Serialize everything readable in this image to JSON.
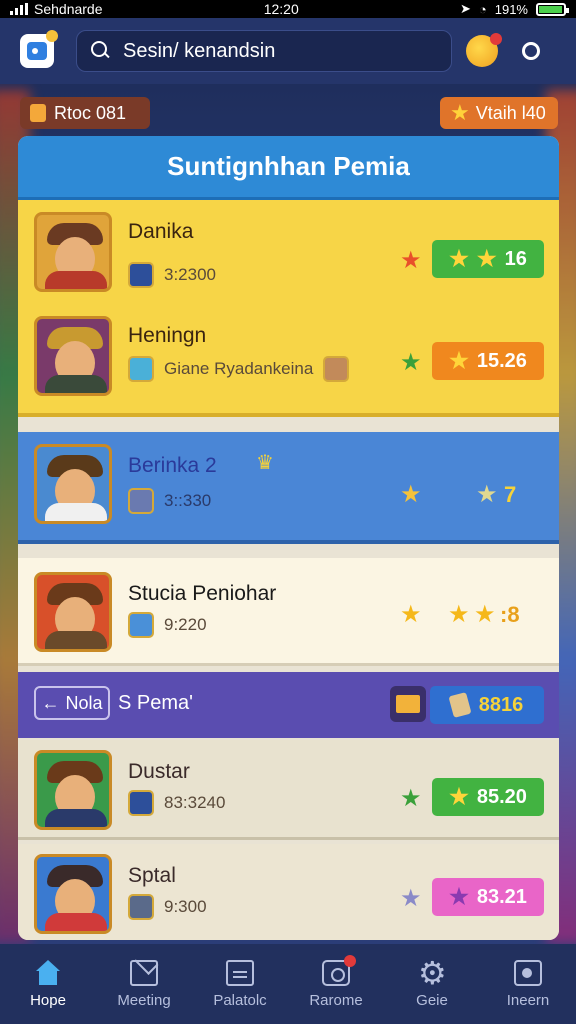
{
  "status_bar": {
    "carrier": "Sehdnarde",
    "time": "12:20",
    "battery": "191%"
  },
  "search": {
    "value": "Sesin/ kenandsin"
  },
  "pills": {
    "left_label": "Rtoc 081",
    "right_label": "Vtaih l40"
  },
  "board": {
    "title": "Suntignhhan Pemia",
    "rows": [
      {
        "name": "Danika",
        "sub": "3:2300",
        "score": "16",
        "score_color": "#42b341"
      },
      {
        "name": "Heningn",
        "sub": "Giane Ryadankeina",
        "score": "15.26",
        "score_color": "#f0881e"
      },
      {
        "name": "Berinka 2",
        "sub": "3::330",
        "score": "7"
      },
      {
        "name": "Stucia Peniohar",
        "sub": "9:220",
        "score": ":8"
      }
    ],
    "section": {
      "back_label": "Nola",
      "title": "S Pema'",
      "score": "8816"
    },
    "section_rows": [
      {
        "name": "Dustar",
        "sub": "83:3240",
        "score": "85.20",
        "score_color": "#42b341"
      },
      {
        "name": "Sptal",
        "sub": "9:300",
        "score": "83.21",
        "score_color": "#e965c8"
      }
    ]
  },
  "nav": [
    {
      "label": "Hope",
      "icon": "home-icon",
      "active": true
    },
    {
      "label": "Meeting",
      "icon": "mail-icon"
    },
    {
      "label": "Palatolc",
      "icon": "note-icon"
    },
    {
      "label": "Rarome",
      "icon": "camera-icon"
    },
    {
      "label": "Geie",
      "icon": "gear-icon"
    },
    {
      "label": "Ineern",
      "icon": "profile-icon"
    }
  ],
  "colors": {
    "accent": "#2e8ad6",
    "highlight": "#f7d547",
    "nav_bg": "#22305e"
  }
}
